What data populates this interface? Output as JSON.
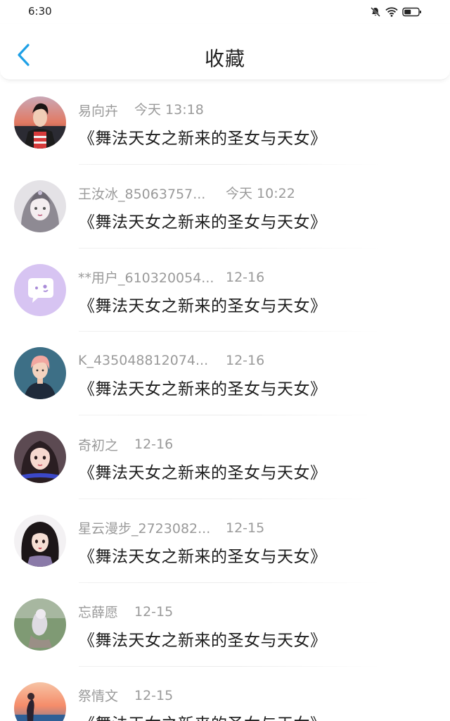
{
  "status_bar": {
    "time": "6:30",
    "icons": [
      "mute-bell-icon",
      "wifi-icon",
      "battery-icon"
    ]
  },
  "header": {
    "back_icon": "chevron-left-icon",
    "title": "收藏"
  },
  "colors": {
    "accent": "#1ea0e6",
    "meta_text": "#9a9a9a",
    "title_text": "#1f1f1f"
  },
  "items": [
    {
      "username": "易向卉",
      "time": "今天 13:18",
      "title": "《舞法天女之新来的圣女与天女》"
    },
    {
      "username": "王汝冰_85063757...",
      "time": "今天 10:22",
      "title": "《舞法天女之新来的圣女与天女》"
    },
    {
      "username": "**用户_610320054...",
      "time": "12-16",
      "title": "《舞法天女之新来的圣女与天女》"
    },
    {
      "username": "K_435048812074...",
      "time": "12-16",
      "title": "《舞法天女之新来的圣女与天女》"
    },
    {
      "username": "奇初之",
      "time": "12-16",
      "title": "《舞法天女之新来的圣女与天女》"
    },
    {
      "username": "星云漫步_2723082...",
      "time": "12-15",
      "title": "《舞法天女之新来的圣女与天女》"
    },
    {
      "username": "忘薛愿",
      "time": "12-15",
      "title": "《舞法天女之新来的圣女与天女》"
    },
    {
      "username": "祭情文",
      "time": "12-15",
      "title": "《舞法天女之新来的圣女与天女》"
    }
  ]
}
